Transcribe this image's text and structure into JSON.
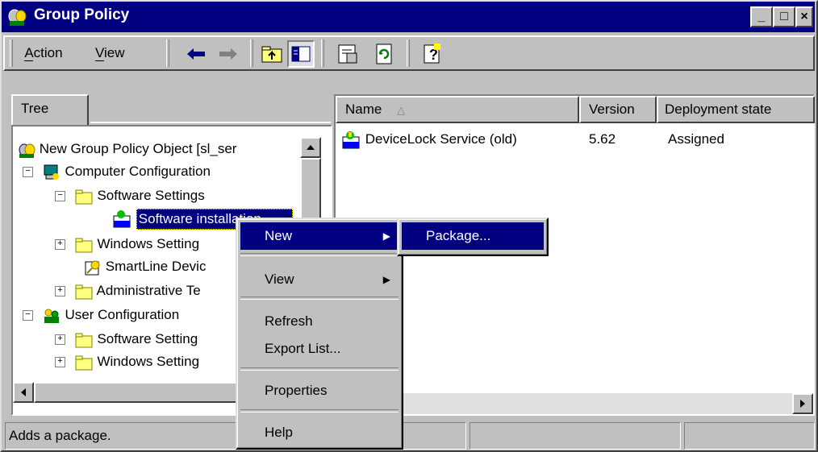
{
  "window": {
    "title": "Group Policy"
  },
  "menubar": {
    "action": "Action",
    "view": "View"
  },
  "toolbar_icons": [
    "back-icon",
    "forward-icon",
    "up-folder-icon",
    "show-tree-icon",
    "properties-icon",
    "refresh-icon",
    "help-icon"
  ],
  "tree": {
    "tab_label": "Tree",
    "items": [
      {
        "label": "New Group Policy Object [sl_ser"
      },
      {
        "label": "Computer Configuration"
      },
      {
        "label": "Software Settings"
      },
      {
        "label": "Software installation"
      },
      {
        "label": "Windows Setting"
      },
      {
        "label": "SmartLine Devic"
      },
      {
        "label": "Administrative Te"
      },
      {
        "label": "User Configuration"
      },
      {
        "label": "Software Setting"
      },
      {
        "label": "Windows Setting"
      }
    ]
  },
  "list": {
    "columns": [
      "Name",
      "Version",
      "Deployment state"
    ],
    "rows": [
      {
        "name": "DeviceLock Service (old)",
        "version": "5.62",
        "state": "Assigned"
      }
    ]
  },
  "context_menu": {
    "items": [
      {
        "label": "New",
        "submenu": true
      },
      {
        "label": "View",
        "submenu": true
      },
      {
        "label": "Refresh"
      },
      {
        "label": "Export List..."
      },
      {
        "label": "Properties"
      },
      {
        "label": "Help"
      }
    ]
  },
  "submenu": {
    "items": [
      {
        "label": "Package..."
      }
    ]
  },
  "status": {
    "text": "Adds a package."
  },
  "colors": {
    "titlebar": "#000080",
    "highlight": "#000080",
    "face": "#c0c0c0"
  }
}
